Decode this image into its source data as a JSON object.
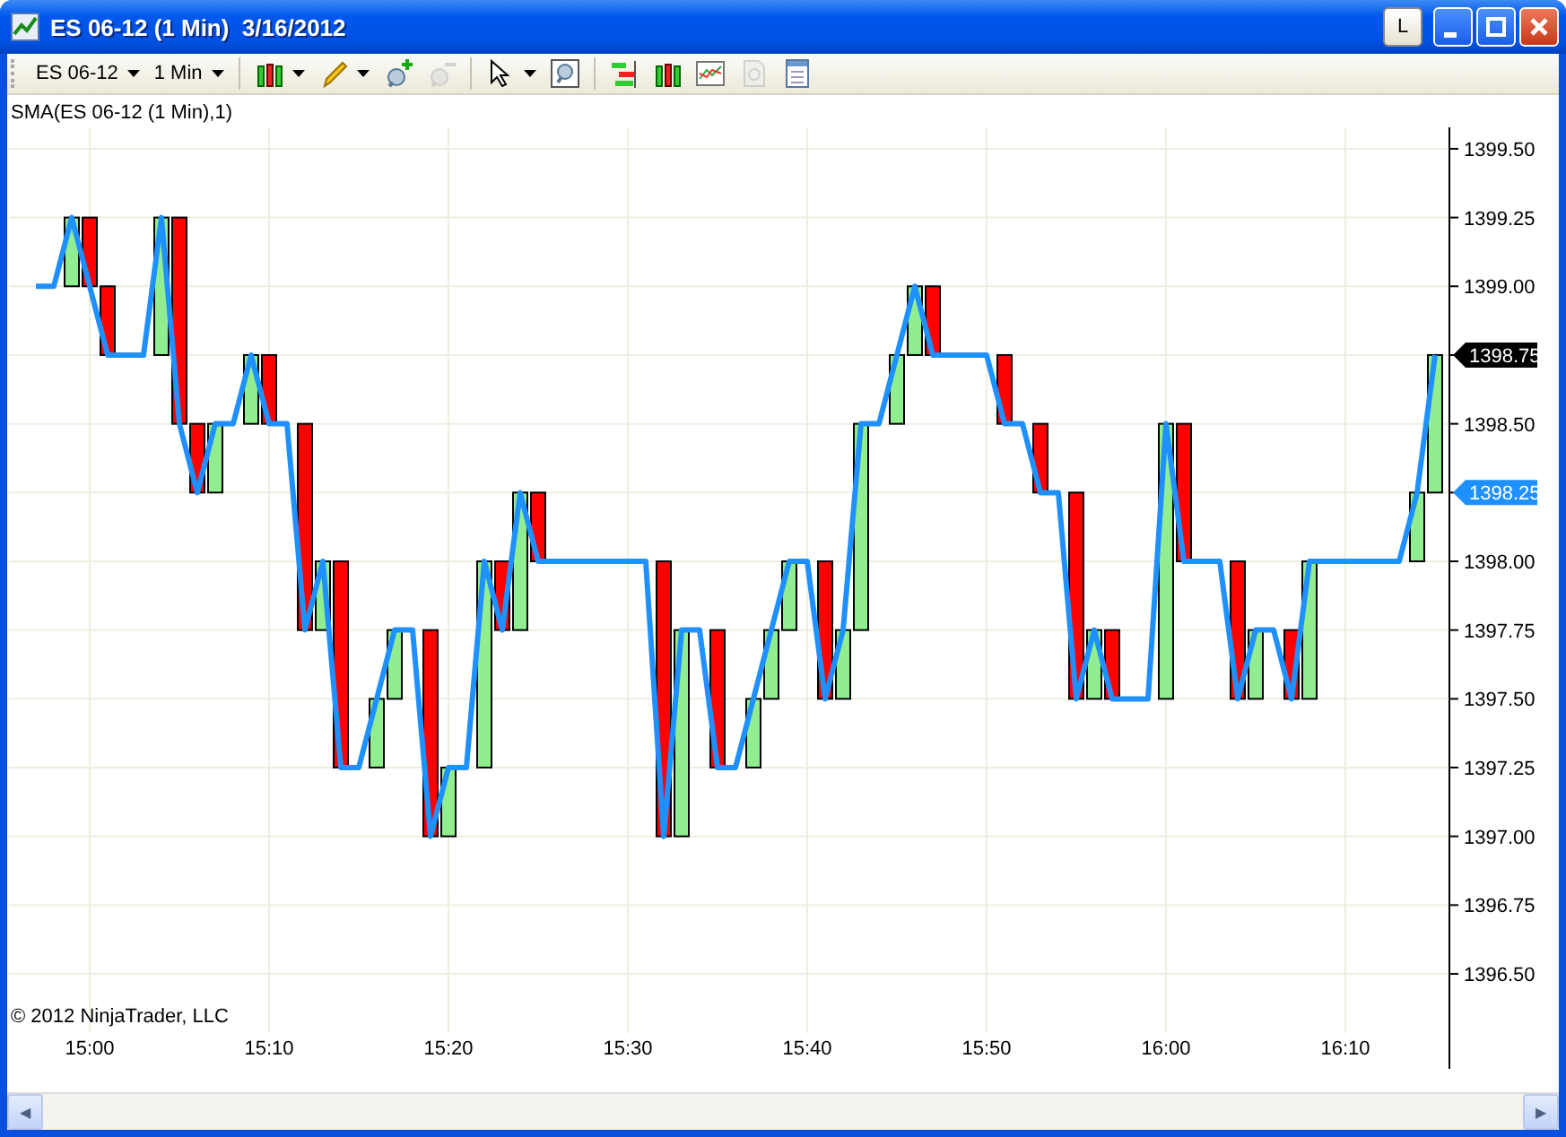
{
  "window": {
    "title": "ES 06-12 (1 Min)  3/16/2012",
    "buttons": [
      {
        "kind": "letter",
        "label": "L"
      },
      {
        "kind": "minimize"
      },
      {
        "kind": "maximize"
      },
      {
        "kind": "close"
      }
    ]
  },
  "toolbar": {
    "items": [
      {
        "kind": "dropdown",
        "label": "ES 06-12"
      },
      {
        "kind": "dropdown",
        "label": "1 Min"
      },
      {
        "kind": "separator"
      },
      {
        "kind": "candles",
        "menu": true
      },
      {
        "kind": "pencil",
        "menu": true
      },
      {
        "kind": "zoom-in"
      },
      {
        "kind": "zoom-out",
        "disabled": true
      },
      {
        "kind": "separator"
      },
      {
        "kind": "pointer",
        "menu": true
      },
      {
        "kind": "magnifier"
      },
      {
        "kind": "separator"
      },
      {
        "kind": "bars"
      },
      {
        "kind": "candles"
      },
      {
        "kind": "chart"
      },
      {
        "kind": "document",
        "disabled": true
      },
      {
        "kind": "panel"
      }
    ]
  },
  "chart": {
    "copyright": "© 2012 NinjaTrader, LLC",
    "price_markers": [
      {
        "label": "1398.75",
        "color": "#000000"
      },
      {
        "label": "1398.25",
        "color": "#1e90ff"
      }
    ],
    "chart_data": {
      "type": "line",
      "grid": true,
      "ylim": [
        1396.285,
        1399.578
      ],
      "yticks": [
        {
          "value": 1396.5,
          "label": "1396.50"
        },
        {
          "value": 1396.75,
          "label": "1396.75"
        },
        {
          "value": 1397,
          "label": "1397.00"
        },
        {
          "value": 1397.25,
          "label": "1397.25"
        },
        {
          "value": 1397.5,
          "label": "1397.50"
        },
        {
          "value": 1397.75,
          "label": "1397.75"
        },
        {
          "value": 1398,
          "label": "1398.00"
        },
        {
          "value": 1398.25
        },
        {
          "value": 1398.5,
          "label": "1398.50"
        },
        {
          "value": 1398.75
        },
        {
          "value": 1399,
          "label": "1399.00"
        },
        {
          "value": 1399.25,
          "label": "1399.25"
        },
        {
          "value": 1399.5,
          "label": "1399.50"
        }
      ],
      "categories": [
        null,
        null,
        null,
        "15:00",
        null,
        null,
        null,
        null,
        null,
        null,
        null,
        null,
        null,
        "15:10",
        null,
        null,
        null,
        null,
        null,
        null,
        null,
        null,
        null,
        "15:20",
        null,
        null,
        null,
        null,
        null,
        null,
        null,
        null,
        null,
        "15:30",
        null,
        null,
        null,
        null,
        null,
        null,
        null,
        null,
        null,
        "15:40",
        null,
        null,
        null,
        null,
        null,
        null,
        null,
        null,
        null,
        "15:50",
        null,
        null,
        null,
        null,
        null,
        null,
        null,
        null,
        null,
        "16:00",
        null,
        null,
        null,
        null,
        null,
        null,
        null,
        null,
        null,
        "16:10",
        null,
        null,
        null,
        null,
        null
      ],
      "series": [
        {
          "name": "SMA(ES 06-12 (1 Min),1)",
          "color": "#1e90ff",
          "values": [
            1399,
            1399,
            1399.25,
            1399,
            1398.75,
            1398.75,
            1398.75,
            1399.25,
            1398.5,
            1398.25,
            1398.5,
            1398.5,
            1398.75,
            1398.5,
            1398.5,
            1397.75,
            1398,
            1397.25,
            1397.25,
            1397.5,
            1397.75,
            1397.75,
            1397,
            1397.25,
            1397.25,
            1398,
            1397.75,
            1398.25,
            1398,
            1398,
            1398,
            1398,
            1398,
            1398,
            1398,
            1397,
            1397.75,
            1397.75,
            1397.25,
            1397.25,
            1397.5,
            1397.75,
            1398,
            1398,
            1397.5,
            1397.75,
            1398.5,
            1398.5,
            1398.75,
            1399,
            1398.75,
            1398.75,
            1398.75,
            1398.75,
            1398.5,
            1398.5,
            1398.25,
            1398.25,
            1397.5,
            1397.75,
            1397.5,
            1397.5,
            1397.5,
            1398.5,
            1398,
            1398,
            1398,
            1397.5,
            1397.75,
            1397.75,
            1397.5,
            1398,
            1398,
            1398,
            1398,
            1398,
            1398,
            1398.25,
            1398.75
          ]
        }
      ]
    }
  },
  "scrollbar": {
    "left": "◀",
    "right": "▶"
  }
}
